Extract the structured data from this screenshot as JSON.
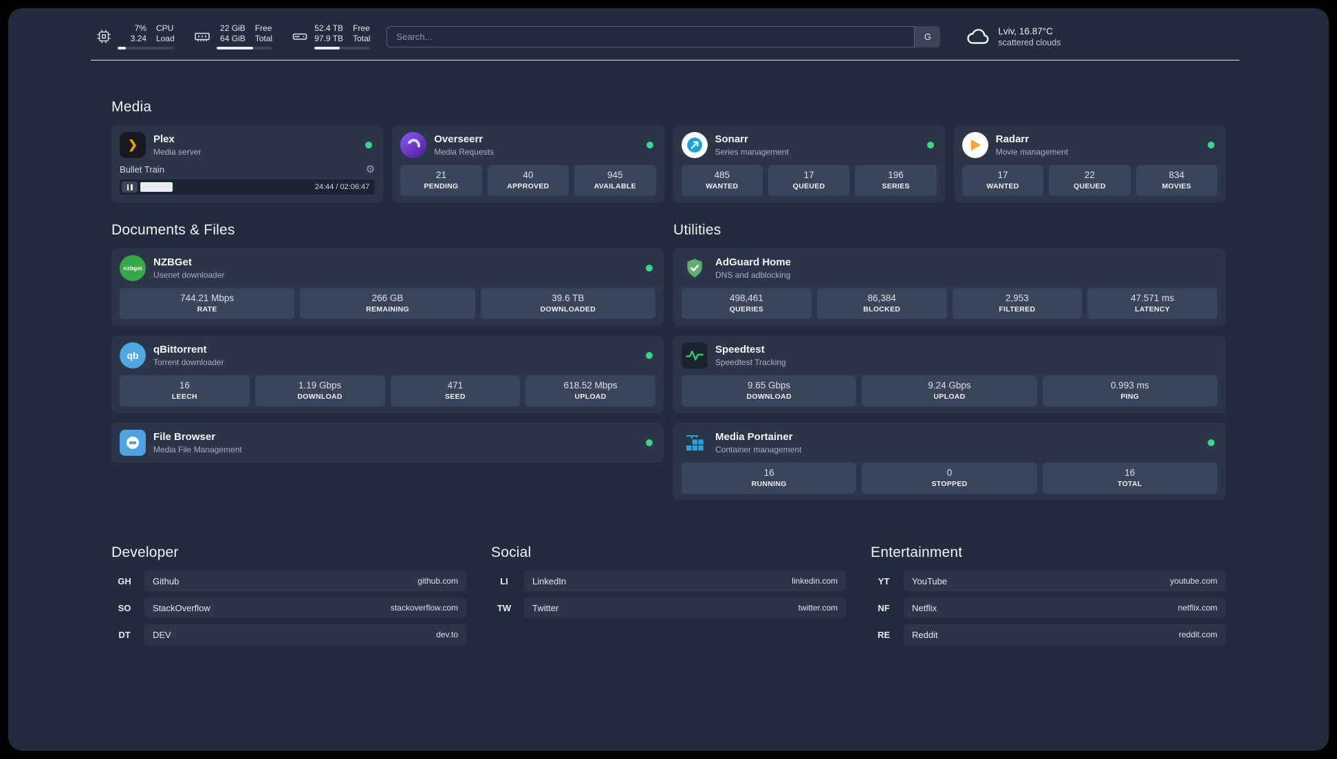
{
  "topbar": {
    "cpu": {
      "value1": "7%",
      "value2": "3.24",
      "label1": "CPU",
      "label2": "Load",
      "progress": 15
    },
    "memory": {
      "value1": "22 GiB",
      "value2": "64 GiB",
      "label1": "Free",
      "label2": "Total",
      "progress": 66
    },
    "storage": {
      "value1": "52.4 TB",
      "value2": "97.9 TB",
      "label1": "Free",
      "label2": "Total",
      "progress": 46
    },
    "search": {
      "placeholder": "Search...",
      "button_label": "G"
    },
    "weather": {
      "location": "Lviv, 16.87°C",
      "condition": "scattered clouds"
    }
  },
  "sections": {
    "media": "Media",
    "documents": "Documents & Files",
    "utilities": "Utilities",
    "developer": "Developer",
    "social": "Social",
    "entertainment": "Entertainment"
  },
  "apps": {
    "plex": {
      "name": "Plex",
      "desc": "Media server",
      "now_playing": "Bullet Train",
      "time": "24:44 / 02:06:47",
      "progress": 13
    },
    "overseerr": {
      "name": "Overseerr",
      "desc": "Media Requests",
      "stats": [
        {
          "value": "21",
          "label": "PENDING"
        },
        {
          "value": "40",
          "label": "APPROVED"
        },
        {
          "value": "945",
          "label": "AVAILABLE"
        }
      ]
    },
    "sonarr": {
      "name": "Sonarr",
      "desc": "Series management",
      "stats": [
        {
          "value": "485",
          "label": "WANTED"
        },
        {
          "value": "17",
          "label": "QUEUED"
        },
        {
          "value": "196",
          "label": "SERIES"
        }
      ]
    },
    "radarr": {
      "name": "Radarr",
      "desc": "Movie management",
      "stats": [
        {
          "value": "17",
          "label": "WANTED"
        },
        {
          "value": "22",
          "label": "QUEUED"
        },
        {
          "value": "834",
          "label": "MOVIES"
        }
      ]
    },
    "nzbget": {
      "name": "NZBGet",
      "desc": "Usenet downloader",
      "stats": [
        {
          "value": "744.21 Mbps",
          "label": "RATE"
        },
        {
          "value": "266 GB",
          "label": "REMAINING"
        },
        {
          "value": "39.6 TB",
          "label": "DOWNLOADED"
        }
      ]
    },
    "qbittorrent": {
      "name": "qBittorrent",
      "desc": "Torrent downloader",
      "stats": [
        {
          "value": "16",
          "label": "LEECH"
        },
        {
          "value": "1.19 Gbps",
          "label": "DOWNLOAD"
        },
        {
          "value": "471",
          "label": "SEED"
        },
        {
          "value": "618.52 Mbps",
          "label": "UPLOAD"
        }
      ]
    },
    "filebrowser": {
      "name": "File Browser",
      "desc": "Media File Management"
    },
    "adguard": {
      "name": "AdGuard Home",
      "desc": "DNS and adblocking",
      "stats": [
        {
          "value": "498,461",
          "label": "QUERIES"
        },
        {
          "value": "86,384",
          "label": "BLOCKED"
        },
        {
          "value": "2,953",
          "label": "FILTERED"
        },
        {
          "value": "47.571 ms",
          "label": "LATENCY"
        }
      ]
    },
    "speedtest": {
      "name": "Speedtest",
      "desc": "Speedtest Tracking",
      "stats": [
        {
          "value": "9.65 Gbps",
          "label": "DOWNLOAD"
        },
        {
          "value": "9.24 Gbps",
          "label": "UPLOAD"
        },
        {
          "value": "0.993 ms",
          "label": "PING"
        }
      ]
    },
    "portainer": {
      "name": "Media Portainer",
      "desc": "Container management",
      "stats": [
        {
          "value": "16",
          "label": "RUNNING"
        },
        {
          "value": "0",
          "label": "STOPPED"
        },
        {
          "value": "16",
          "label": "TOTAL"
        }
      ]
    }
  },
  "icons": {
    "plex_glyph": "❯",
    "gear_glyph": "⚙",
    "nzbget_text": "nzbget",
    "qbittorrent_text": "qb"
  },
  "bookmarks": {
    "developer": [
      {
        "abbr": "GH",
        "name": "Github",
        "url": "github.com"
      },
      {
        "abbr": "SO",
        "name": "StackOverflow",
        "url": "stackoverflow.com"
      },
      {
        "abbr": "DT",
        "name": "DEV",
        "url": "dev.to"
      }
    ],
    "social": [
      {
        "abbr": "LI",
        "name": "LinkedIn",
        "url": "linkedin.com"
      },
      {
        "abbr": "TW",
        "name": "Twitter",
        "url": "twitter.com"
      }
    ],
    "entertainment": [
      {
        "abbr": "YT",
        "name": "YouTube",
        "url": "youtube.com"
      },
      {
        "abbr": "NF",
        "name": "Netflix",
        "url": "netflix.com"
      },
      {
        "abbr": "RE",
        "name": "Reddit",
        "url": "reddit.com"
      }
    ]
  },
  "colors": {
    "status_online": "#3dd68c",
    "plex_accent": "#e5a00d",
    "background": "#212c3d"
  }
}
